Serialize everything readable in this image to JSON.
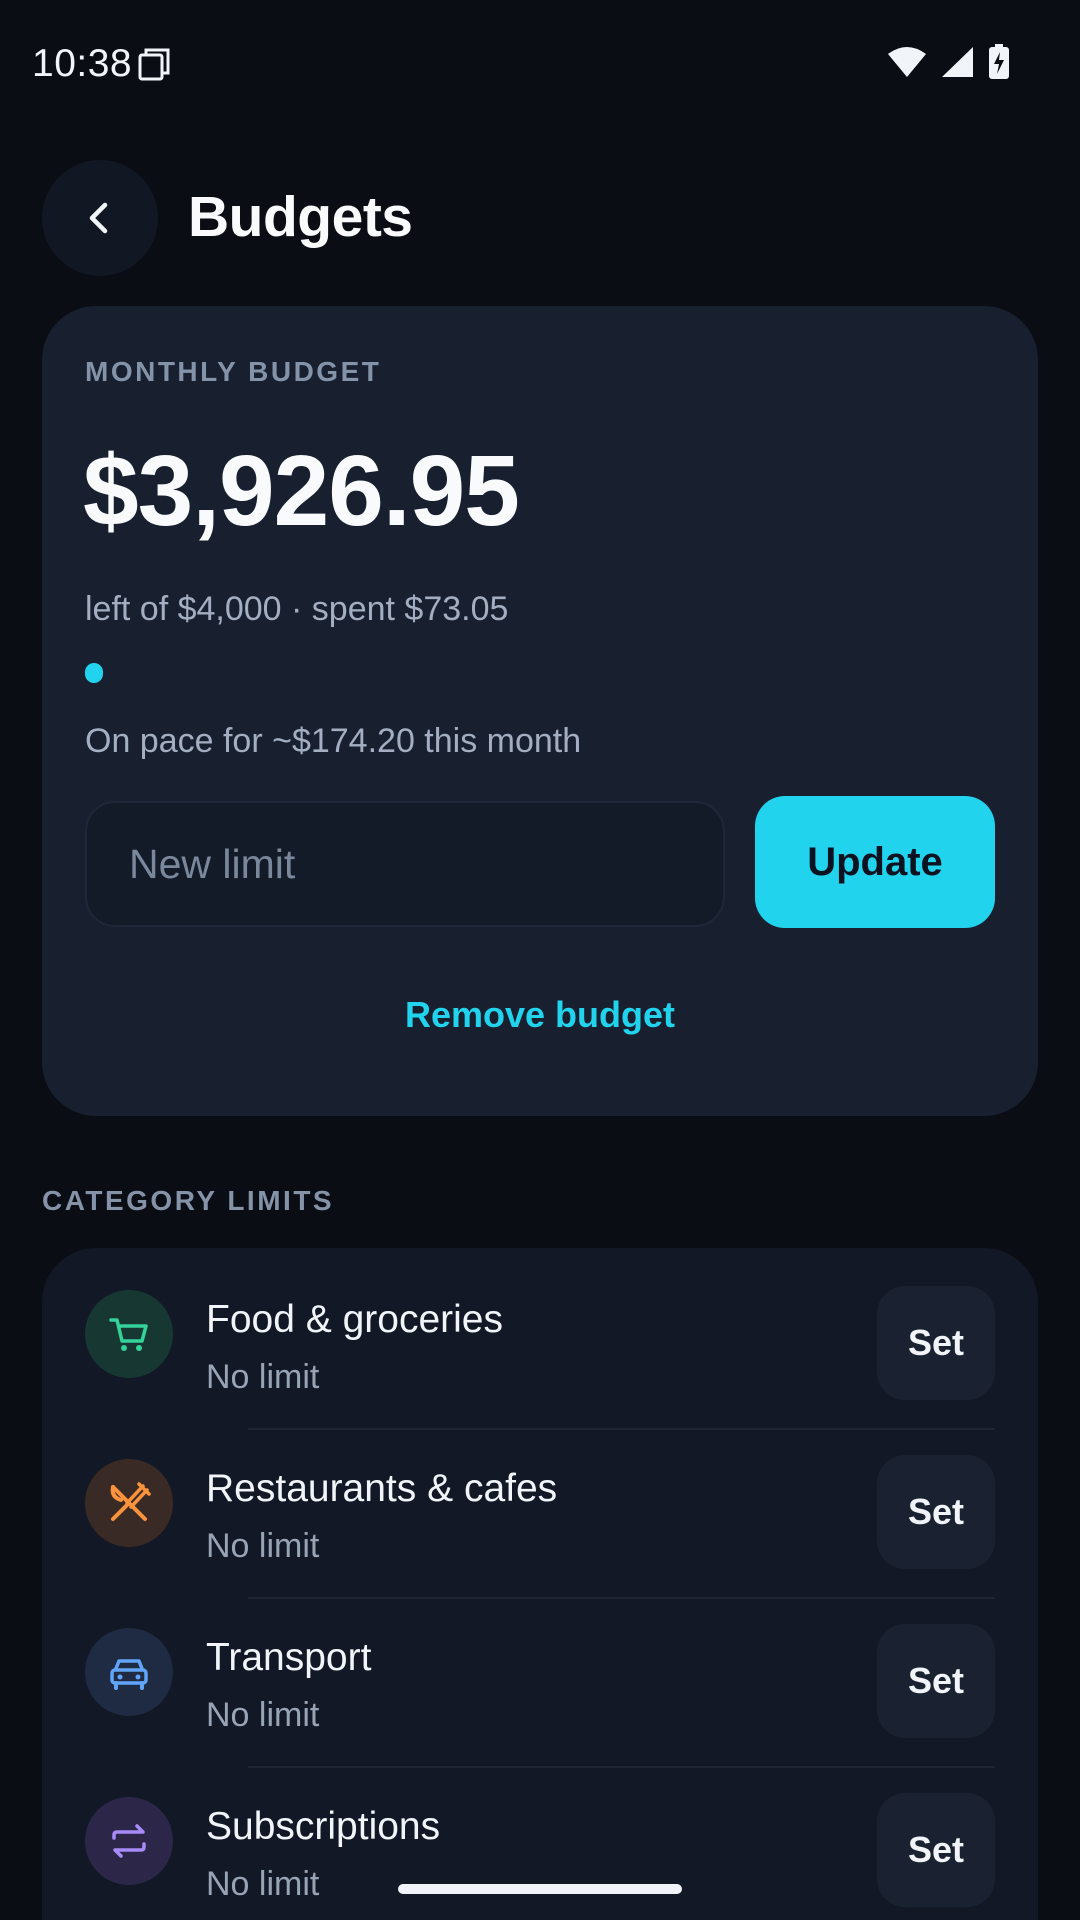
{
  "status_bar": {
    "time": "10:38",
    "icons": [
      "sim-card-icon",
      "wifi-icon",
      "signal-icon",
      "battery-charging-icon"
    ]
  },
  "header": {
    "back_icon": "chevron-left-icon",
    "title": "Budgets"
  },
  "monthly_budget": {
    "label": "MONTHLY BUDGET",
    "amount_left": "$3,926.95",
    "summary": "left of $4,000 · spent $73.05",
    "progress_fraction": 0.018,
    "pace": "On pace for ~$174.20 this month",
    "input_placeholder": "New limit",
    "input_value": "",
    "update_label": "Update",
    "remove_label": "Remove budget"
  },
  "category_limits": {
    "section_label": "CATEGORY LIMITS",
    "items": [
      {
        "name": "Food & groceries",
        "limit": "No limit",
        "set_label": "Set",
        "icon": "shopping-cart-icon",
        "icon_color": "#34d399",
        "icon_bg": "#173832"
      },
      {
        "name": "Restaurants & cafes",
        "limit": "No limit",
        "set_label": "Set",
        "icon": "fork-knife-icon",
        "icon_color": "#fb923c",
        "icon_bg": "#3a2a25"
      },
      {
        "name": "Transport",
        "limit": "No limit",
        "set_label": "Set",
        "icon": "car-icon",
        "icon_color": "#60a5fa",
        "icon_bg": "#1e2b43"
      },
      {
        "name": "Subscriptions",
        "limit": "No limit",
        "set_label": "Set",
        "icon": "repeat-icon",
        "icon_color": "#a78bfa",
        "icon_bg": "#2c2748"
      }
    ]
  },
  "colors": {
    "accent": "#22d3ee",
    "background": "#0a0d13",
    "card": "#182030"
  }
}
